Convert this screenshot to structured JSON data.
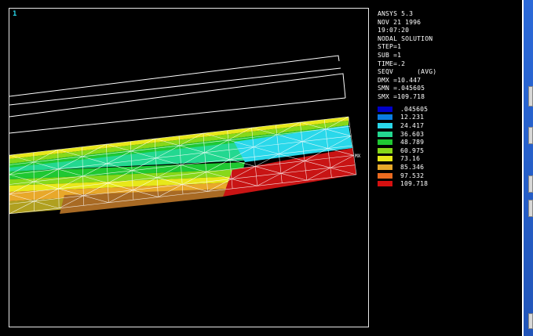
{
  "window_number": "1",
  "header_lines": [
    "ANSYS 5.3",
    "NOV 21 1996",
    "19:07:20",
    "NODAL SOLUTION",
    "STEP=1",
    "SUB =1",
    "TIME=.2",
    "SEQV      (AVG)",
    "DMX =10.447",
    "SMN =.045605",
    "SMX =109.718"
  ],
  "legend": [
    {
      "value": ".045605",
      "color": "#0000c8"
    },
    {
      "value": "12.231",
      "color": "#0a7ce0"
    },
    {
      "value": "24.417",
      "color": "#2ad8ea"
    },
    {
      "value": "36.603",
      "color": "#23d890"
    },
    {
      "value": "48.789",
      "color": "#1fc832"
    },
    {
      "value": "60.975",
      "color": "#86d81a"
    },
    {
      "value": "73.16",
      "color": "#e8e81a"
    },
    {
      "value": "85.346",
      "color": "#e8a82a"
    },
    {
      "value": "97.532",
      "color": "#ea6a20"
    },
    {
      "value": "109.718",
      "color": "#d61010"
    }
  ],
  "max_marker": "MX",
  "colors": {
    "background": "#000000",
    "frame": "#e8e8e8",
    "window_number": "#27d3e6"
  }
}
